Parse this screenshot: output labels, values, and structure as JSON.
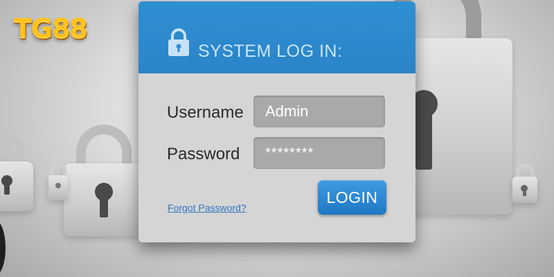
{
  "brand": {
    "logo_text": "TG88",
    "logo_color": "#ffc21a"
  },
  "login_panel": {
    "title": "SYSTEM LOG IN:",
    "header_icon": "padlock-icon",
    "header_color": "#2f8fd2",
    "username_label": "Username",
    "username_value": "Admin",
    "password_label": "Password",
    "password_value": "********",
    "forgot_link": "Forgot Password?",
    "login_button": "LOGIN",
    "button_color": "#2a84c8"
  },
  "background": {
    "icon": "padlock-icon"
  }
}
